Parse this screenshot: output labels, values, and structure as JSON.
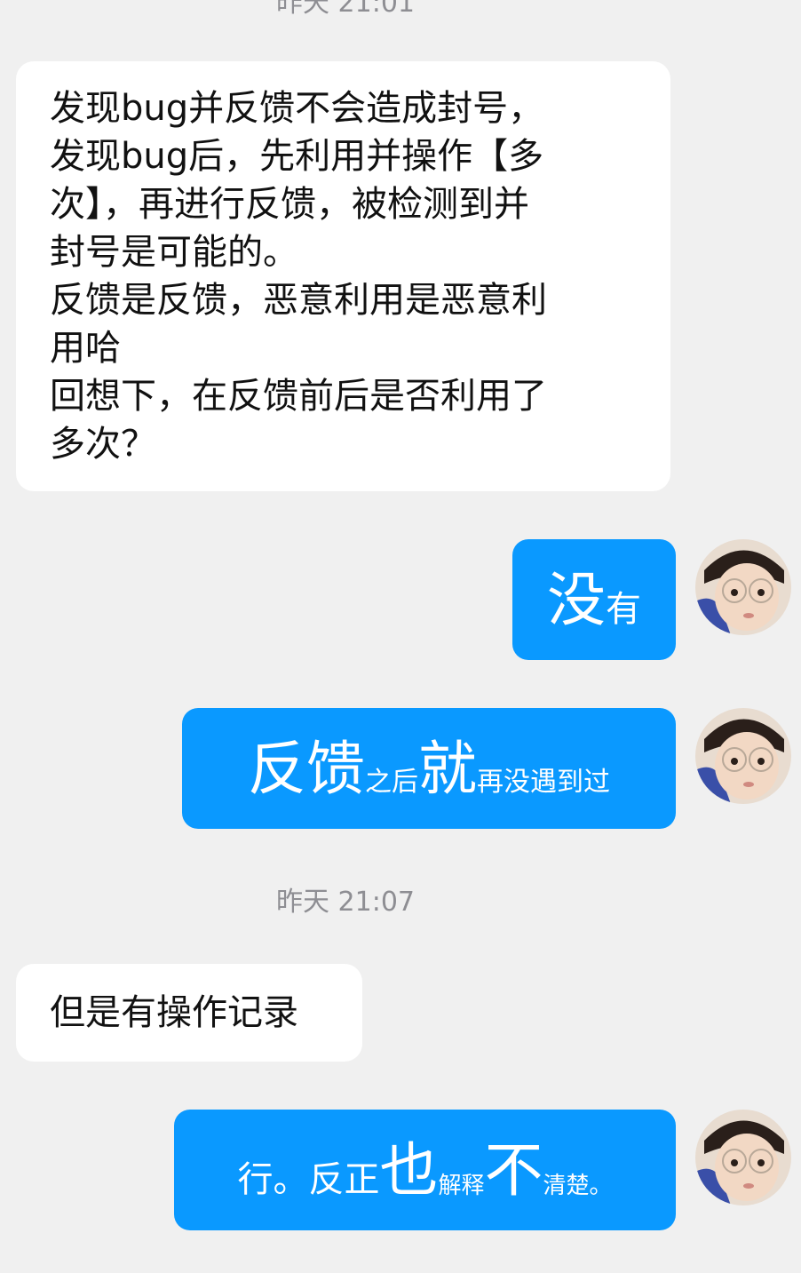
{
  "timestamps": {
    "top": "昨天 21:01",
    "middle": "昨天 21:07"
  },
  "messages": {
    "received_1": {
      "lines": [
        "发现bug并反馈不会造成封号，",
        "发现bug后，先利用并操作【多",
        "次】，再进行反馈，被检测到并",
        "封号是可能的。",
        "反馈是反馈，恶意利用是恶意利",
        "用哈",
        "回想下，在反馈前后是否利用了",
        "多次？"
      ]
    },
    "sent_1": {
      "parts": [
        "没",
        "有"
      ]
    },
    "sent_2": {
      "parts": [
        "反馈",
        "之后",
        "就",
        "再没遇到过"
      ]
    },
    "received_2": {
      "text": "但是有操作记录"
    },
    "sent_3": {
      "parts": [
        "行。反正",
        "也",
        "解释",
        "不",
        "清楚。"
      ]
    }
  },
  "colors": {
    "background": "#f0f0f0",
    "incoming_bubble": "#ffffff",
    "outgoing_bubble": "#0a99ff",
    "timestamp": "#8e8e93"
  },
  "avatar": {
    "icon": "user-avatar-child-with-glasses"
  }
}
